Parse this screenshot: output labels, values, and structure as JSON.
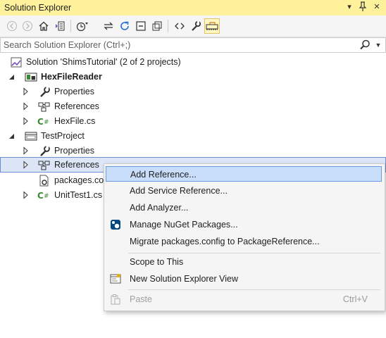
{
  "window": {
    "title": "Solution Explorer",
    "pin_glyph": "▾",
    "pushpin_glyph": "⊥",
    "close_glyph": "✕"
  },
  "toolbar": {
    "buttons": [
      "back-icon",
      "forward-icon",
      "home-icon",
      "switch-views-icon",
      "pending-changes-filter-icon",
      "sync-with-active-document-icon",
      "refresh-icon",
      "collapse-all-icon",
      "show-all-files-icon",
      "preview-selected-items-icon",
      "properties-icon",
      "preview-active-icon"
    ],
    "active_color": "#fff7c2"
  },
  "search": {
    "placeholder": "Search Solution Explorer (Ctrl+;)",
    "value": ""
  },
  "tree": {
    "solution_label": "Solution 'ShimsTutorial' (2 of 2 projects)",
    "items": [
      {
        "label": "HexFileReader",
        "icon": "csharp-project-icon"
      },
      {
        "label": "Properties",
        "icon": "wrench-icon"
      },
      {
        "label": "References",
        "icon": "references-icon"
      },
      {
        "label": "HexFile.cs",
        "icon": "csharp-file-icon"
      },
      {
        "label": "TestProject",
        "icon": "test-project-icon"
      },
      {
        "label": "Properties",
        "icon": "wrench-icon"
      },
      {
        "label": "References",
        "icon": "references-icon"
      },
      {
        "label": "packages.con",
        "icon": "config-file-icon"
      },
      {
        "label": "UnitTest1.cs",
        "icon": "csharp-file-icon"
      }
    ],
    "selection_color": "#dce6f7"
  },
  "context_menu": {
    "items": [
      {
        "label": "Add Reference..."
      },
      {
        "label": "Add Service Reference..."
      },
      {
        "label": "Add Analyzer..."
      },
      {
        "label": "Manage NuGet Packages...",
        "icon": "nuget-icon"
      },
      {
        "label": "Migrate packages.config to PackageReference..."
      },
      {
        "label": "Scope to This"
      },
      {
        "label": "New Solution Explorer View",
        "icon": "new-view-icon"
      },
      {
        "label": "Paste",
        "shortcut": "Ctrl+V",
        "icon": "paste-icon"
      }
    ],
    "highlight_color": "#c9defa"
  }
}
